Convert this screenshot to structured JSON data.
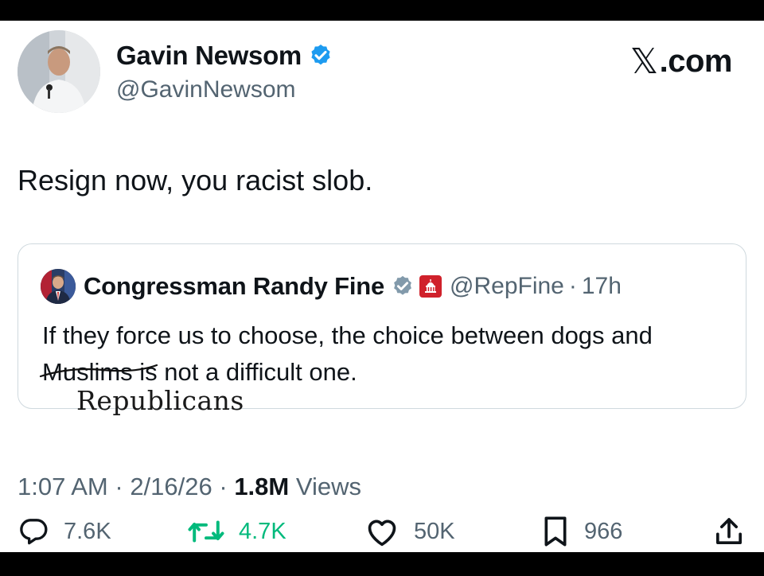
{
  "author": {
    "display_name": "Gavin Newsom",
    "handle": "@GavinNewsom"
  },
  "brand": {
    "x_symbol": "𝕏",
    "text": ".com"
  },
  "tweet": {
    "text": "Resign now, you racist slob."
  },
  "quote": {
    "display_name": "Congressman Randy Fine",
    "handle": "@RepFine",
    "separator": "·",
    "time": "17h",
    "text_before": "If they force us to choose, the choice between dogs and ",
    "struck_word": "Muslims",
    "text_after": " is not a difficult one.",
    "handwritten_replacement": "Republicans"
  },
  "meta": {
    "time": "1:07 AM",
    "sep1": " · ",
    "date": "2/16/26",
    "sep2": " · ",
    "views_count": "1.8M",
    "views_label": " Views"
  },
  "actions": {
    "replies": "7.6K",
    "reposts": "4.7K",
    "likes": "50K",
    "bookmarks": "966"
  },
  "colors": {
    "verified": "#1d9bf0",
    "repost_green": "#00ba7c",
    "gov_badge": "#d0212b",
    "muted": "#536471"
  },
  "icons": [
    "verified-badge-icon",
    "reply-icon",
    "repost-icon",
    "like-icon",
    "bookmark-icon",
    "share-icon",
    "government-badge-icon"
  ]
}
